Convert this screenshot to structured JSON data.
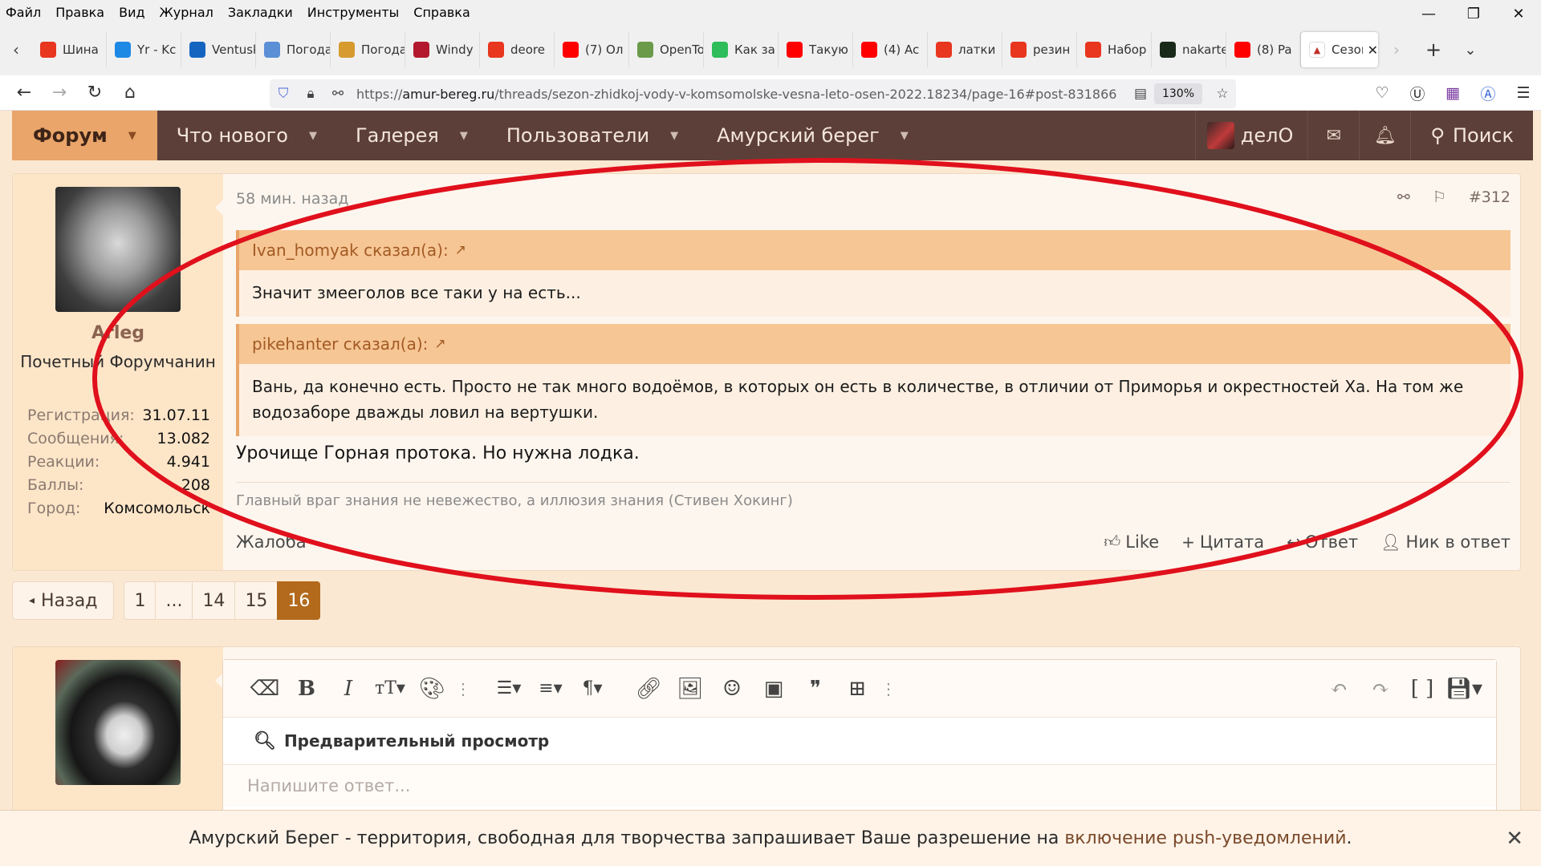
{
  "menubar": [
    "Файл",
    "Правка",
    "Вид",
    "Журнал",
    "Закладки",
    "Инструменты",
    "Справка"
  ],
  "tabs": [
    {
      "label": "Шина",
      "color": "#e8361f"
    },
    {
      "label": "Yr - Kc",
      "color": "#1e88e5"
    },
    {
      "label": "Ventusky",
      "color": "#1565c0"
    },
    {
      "label": "Погода",
      "color": "#5b8fd6"
    },
    {
      "label": "Погода",
      "color": "#d69a2e"
    },
    {
      "label": "Windy",
      "color": "#b3182e"
    },
    {
      "label": "deore",
      "color": "#e8361f"
    },
    {
      "label": "(7) Ол",
      "color": "#ff0000"
    },
    {
      "label": "OpenTopo",
      "color": "#6b9a4a"
    },
    {
      "label": "Как за",
      "color": "#2ebd5a"
    },
    {
      "label": "Такую",
      "color": "#ff0000"
    },
    {
      "label": "(4) Ac",
      "color": "#ff0000"
    },
    {
      "label": "латки",
      "color": "#e8361f"
    },
    {
      "label": "резин",
      "color": "#e8361f"
    },
    {
      "label": "Набор",
      "color": "#e8361f"
    },
    {
      "label": "nakarte",
      "color": "#1a2a1a"
    },
    {
      "label": "(8) Pa",
      "color": "#ff0000"
    }
  ],
  "active_tab": {
    "label": "Сезон",
    "close": "✕"
  },
  "urlbar": {
    "scheme": "https://",
    "host": "amur-bereg.ru",
    "path": "/threads/sezon-zhidkoj-vody-v-komsomolske-vesna-leto-osen-2022.18234/page-16#post-831866",
    "zoom": "130%"
  },
  "site_nav": {
    "forum": "Форум",
    "whats_new": "Что нового",
    "gallery": "Галерея",
    "users": "Пользователи",
    "amur_bereg": "Амурский берег",
    "username": "делО",
    "search": "Поиск"
  },
  "post": {
    "time": "58 мин. назад",
    "number": "#312",
    "author": {
      "name": "Arleg",
      "title": "Почетный Форумчанин",
      "stats": [
        {
          "key": "Регистрация:",
          "value": "31.07.11"
        },
        {
          "key": "Сообщения:",
          "value": "13.082"
        },
        {
          "key": "Реакции:",
          "value": "4.941"
        },
        {
          "key": "Баллы:",
          "value": "208"
        },
        {
          "key": "Город:",
          "value": "Комсомольск"
        }
      ]
    },
    "quotes": [
      {
        "header": "Ivan_homyak сказал(а):",
        "body": "Значит змееголов все таки у на есть..."
      },
      {
        "header": "pikehanter сказал(а):",
        "body": "Вань, да конечно есть. Просто не так много водоёмов, в которых он есть в количестве, в отличии от Приморья и окрестностей Ха. На том же водозаборе дважды ловил на вертушки."
      }
    ],
    "text": "Урочище Горная протока. Но нужна лодка.",
    "signature": "Главный враг знания не невежество, а иллюзия знания (Стивен Хокинг)",
    "report": "Жалоба",
    "actions": {
      "like": "Like",
      "quote": "Цитата",
      "reply": "Ответ",
      "nick": "Ник в ответ"
    }
  },
  "pagination": {
    "prev": "Назад",
    "pages": [
      "1",
      "...",
      "14",
      "15",
      "16"
    ],
    "current": "16"
  },
  "editor": {
    "preview": "Предварительный просмотр",
    "placeholder": "Напишите ответ..."
  },
  "push_notice": {
    "text": "Амурский Берег - территория, свободная для творчества запрашивает Ваше разрешение на",
    "link": "включение push-уведомлений",
    "end": "."
  },
  "colors": {
    "nav_bg": "#5c3f38",
    "accent": "#e9a56a",
    "page_current": "#b36a1c",
    "annotation": "#e0101c"
  }
}
